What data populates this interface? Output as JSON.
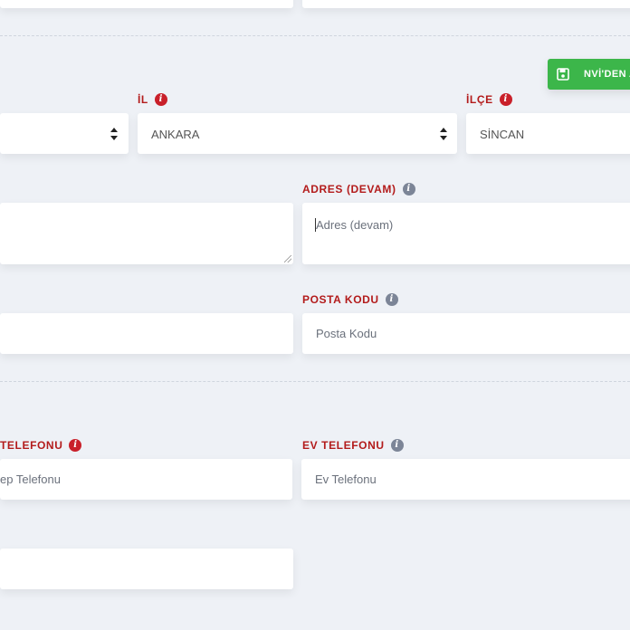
{
  "button": {
    "label": "NVİ'DEN A"
  },
  "fields": {
    "il": {
      "label": "İL",
      "value": "ANKARA"
    },
    "ilce": {
      "label": "İLÇE",
      "value": "SİNCAN"
    },
    "adres_devam": {
      "label": "ADRES (DEVAM)",
      "placeholder": "Adres (devam)"
    },
    "posta_kodu": {
      "label": "POSTA KODU",
      "placeholder": "Posta Kodu"
    },
    "cep_telefonu": {
      "label": "TELEFONU",
      "placeholder": "ep Telefonu"
    },
    "ev_telefonu": {
      "label": "EV TELEFONU",
      "placeholder": "Ev Telefonu"
    }
  },
  "icons": {
    "info": "info-circle-icon",
    "save": "floppy-disk-icon",
    "select": "select-arrows-icon"
  },
  "colors": {
    "label": "#b31b1b",
    "info_required": "#c9202a",
    "info_optional": "#7c8597",
    "button": "#3cb64a",
    "background": "#eef1f6"
  }
}
